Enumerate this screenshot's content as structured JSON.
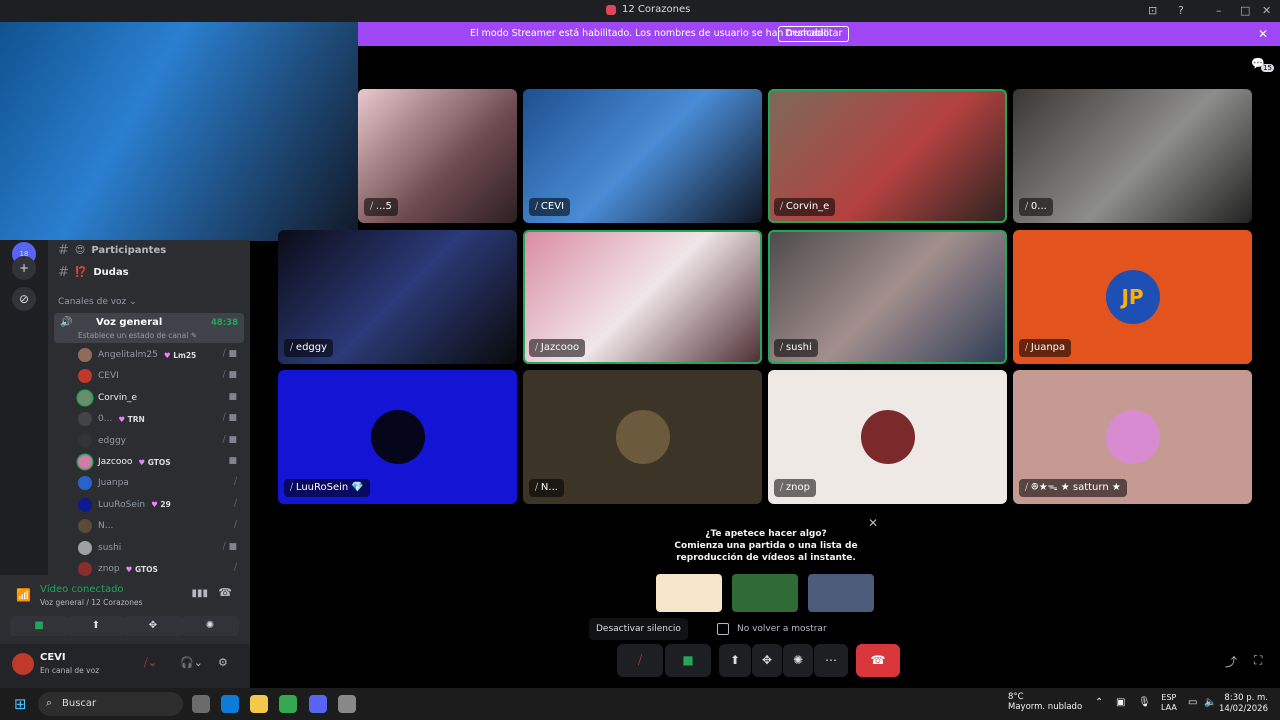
{
  "window": {
    "title": "12 Corazones",
    "controls": [
      "⊡",
      "?",
      "–",
      "□",
      "✕"
    ]
  },
  "banner": {
    "message": "El modo Streamer está habilitado. Los nombres de usuario se han truncado.",
    "button": "Deshabilitar",
    "close": "✕"
  },
  "inbox_count": "15",
  "servers": {
    "badge": "18"
  },
  "channels": [
    {
      "name": "Participantes",
      "hash": "#",
      "emoji": "😍"
    },
    {
      "name": "Dudas",
      "hash": "#",
      "emoji": "⁉️"
    }
  ],
  "voice_category": "Canales de voz ⌄",
  "voice_channel": {
    "name": "Voz general",
    "timer": "48:38",
    "status": "Establece un estado de canal ✎"
  },
  "members": [
    {
      "name": "Angelitalm25",
      "badge": "Lm25",
      "color": "#8e6b5b",
      "icons": "⧸ ■"
    },
    {
      "name": "CEVI",
      "badge": "",
      "color": "#c0392b",
      "icons": "⧸ ■"
    },
    {
      "name": "Corvin_e",
      "badge": "",
      "color": "#6a8c6a",
      "icons": "■",
      "speaking": true
    },
    {
      "name": "0...",
      "badge": "TRN",
      "color": "#444",
      "icons": "⧸ ■"
    },
    {
      "name": "edggy",
      "badge": "",
      "color": "#333",
      "icons": "⧸ ■"
    },
    {
      "name": "Jazcooo",
      "badge": "GTOS",
      "color": "#d27ba8",
      "icons": "■",
      "speaking": true
    },
    {
      "name": "Juanpa",
      "badge": "",
      "color": "#2a62c9",
      "icons": "⧸"
    },
    {
      "name": "LuuRoSein",
      "badge": "29",
      "color": "#0c1a8f",
      "icons": "⧸"
    },
    {
      "name": "N...",
      "badge": "",
      "color": "#5b4a3a",
      "icons": "⧸"
    },
    {
      "name": "sushi",
      "badge": "",
      "color": "#a0a0a0",
      "icons": "⧸ ■"
    },
    {
      "name": "znop",
      "badge": "GTOS",
      "color": "#8b2d2d",
      "icons": "⧸"
    }
  ],
  "voice_panel": {
    "status": "Vídeo conectado",
    "sub": "Voz general / 12 Corazones",
    "buttons": [
      "■",
      "⬆",
      "✥",
      "✺"
    ]
  },
  "user": {
    "name": "CEVI",
    "status": "En canal de voz"
  },
  "tiles": [
    {
      "label": "...5",
      "bg": "linear-gradient(135deg,#e9c9cd,#6c4a4f 60%,#2e1f22)"
    },
    {
      "label": "CEVI",
      "bg": "linear-gradient(135deg,#1d4f8f,#4a8cd6 50%,#101622)"
    },
    {
      "label": "Corvin_e",
      "bg": "linear-gradient(135deg,#7c6a5a,#b4413f 55%,#2a2320)",
      "speaking": true
    },
    {
      "label": "0...",
      "bg": "linear-gradient(135deg,#3a3634,#8d8d8b 55%,#222)"
    },
    {
      "label": "edggy",
      "bg": "linear-gradient(135deg,#0b0b16,#2b3a78 50%,#0a0a0a)"
    },
    {
      "label": "Jazcooo",
      "bg": "linear-gradient(135deg,#d98aa3,#f1e6e9 50%,#4a2c30)",
      "speaking": true
    },
    {
      "label": "sushi",
      "bg": "linear-gradient(135deg,#4b4a4a,#a28f8d 50%,#2d3b55)",
      "speaking": true
    },
    {
      "label": "Juanpa",
      "bg": "#e2531e",
      "avatar": "#1e4fb5",
      "avatar_text": "JP"
    },
    {
      "label": "LuuRoSein 💎",
      "bg": "#1414d4",
      "avatar": "#06061a",
      "avatar_text": ""
    },
    {
      "label": "N...",
      "bg": "#3c3527",
      "avatar": "#6b5a3b",
      "avatar_text": ""
    },
    {
      "label": "znop",
      "bg": "#efe9e6",
      "avatar": "#7a2a2a",
      "avatar_text": ""
    },
    {
      "label": "ꔮ★ᯓ ★ satturn ★",
      "bg": "#c49a92",
      "avatar": "#d98bd1",
      "avatar_text": ""
    }
  ],
  "activity": {
    "question": "¿Te apetece hacer algo?",
    "line1": "Comienza una partida o una lista de",
    "line2": "reproducción de vídeos al instante.",
    "close": "✕",
    "games": [
      "#f5e6c9",
      "#2f6b35",
      "#4d5b7a"
    ]
  },
  "no_show": "No volver a mostrar",
  "tooltip": "Desactivar silencio",
  "controls": {
    "mic": "⧸",
    "camera": "■",
    "share": "⬆",
    "activities": "✥",
    "effects": "✺",
    "more": "⋯",
    "hangup": "☎"
  },
  "taskbar": {
    "search": "Buscar",
    "weather_temp": "8°C",
    "weather_desc": "Mayorm. nublado",
    "lang1": "ESP",
    "lang2": "LAA",
    "time": "8:30 p. m.",
    "date": "14/02/2026",
    "apps": [
      "#6b6b6b",
      "#0f7bd8",
      "#f2c94c",
      "#34a853",
      "#5865f2",
      "#888888"
    ]
  }
}
